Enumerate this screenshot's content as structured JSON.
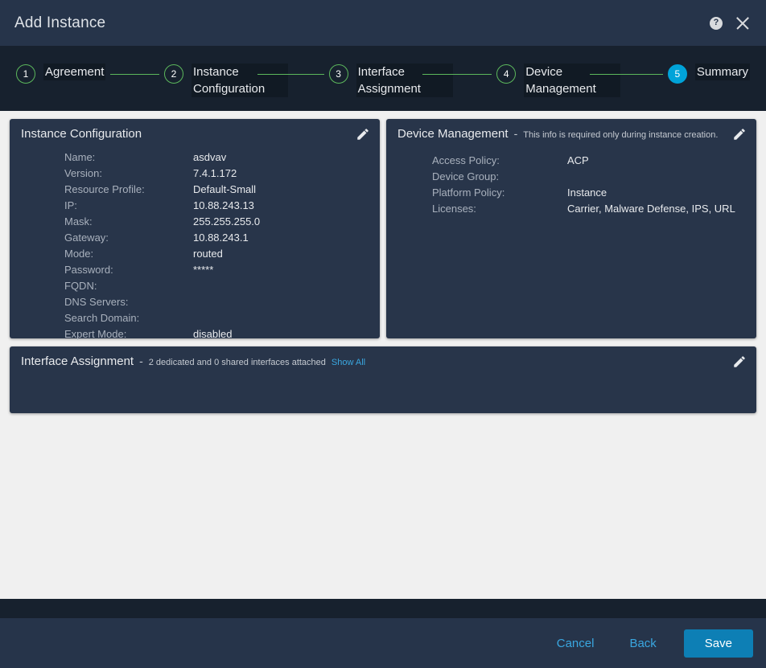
{
  "titlebar": {
    "title": "Add Instance",
    "help_icon": "help-icon",
    "close_icon": "close-icon"
  },
  "stepper": {
    "steps": [
      {
        "number": "1",
        "label": "Agreement",
        "state": "complete"
      },
      {
        "number": "2",
        "label": "Instance Configuration",
        "state": "complete"
      },
      {
        "number": "3",
        "label": "Interface Assignment",
        "state": "complete"
      },
      {
        "number": "4",
        "label": "Device Management",
        "state": "complete"
      },
      {
        "number": "5",
        "label": "Summary",
        "state": "active"
      }
    ],
    "active_color": "#00a3d9",
    "complete_color": "#5cb85c"
  },
  "cards": {
    "instance_configuration": {
      "title": "Instance Configuration",
      "edit_icon": "pencil-icon",
      "rows": [
        {
          "label": "Name:",
          "value": "asdvav"
        },
        {
          "label": "Version:",
          "value": "7.4.1.172"
        },
        {
          "label": "Resource Profile:",
          "value": "Default-Small"
        },
        {
          "label": "IP:",
          "value": "10.88.243.13"
        },
        {
          "label": "Mask:",
          "value": "255.255.255.0"
        },
        {
          "label": "Gateway:",
          "value": "10.88.243.1"
        },
        {
          "label": "Mode:",
          "value": "routed"
        },
        {
          "label": "Password:",
          "value": "*****"
        },
        {
          "label": "FQDN:",
          "value": ""
        },
        {
          "label": "DNS Servers:",
          "value": ""
        },
        {
          "label": "Search Domain:",
          "value": ""
        },
        {
          "label": "Expert Mode:",
          "value": "disabled"
        }
      ]
    },
    "device_management": {
      "title": "Device Management",
      "dash": "-",
      "note": "This info is required only during instance creation.",
      "edit_icon": "pencil-icon",
      "rows": [
        {
          "label": "Access Policy:",
          "value": "ACP"
        },
        {
          "label": "Device Group:",
          "value": ""
        },
        {
          "label": "Platform Policy:",
          "value": "Instance"
        },
        {
          "label": "Licenses:",
          "value": "Carrier, Malware Defense, IPS, URL"
        }
      ]
    },
    "interface_assignment": {
      "title": "Interface Assignment",
      "dash": "-",
      "note": "2 dedicated and 0 shared interfaces attached",
      "link": "Show All",
      "edit_icon": "pencil-icon"
    }
  },
  "footer": {
    "cancel_label": "Cancel",
    "back_label": "Back",
    "save_label": "Save",
    "save_color": "#0d7fb5",
    "link_color": "#3aa7e0"
  }
}
